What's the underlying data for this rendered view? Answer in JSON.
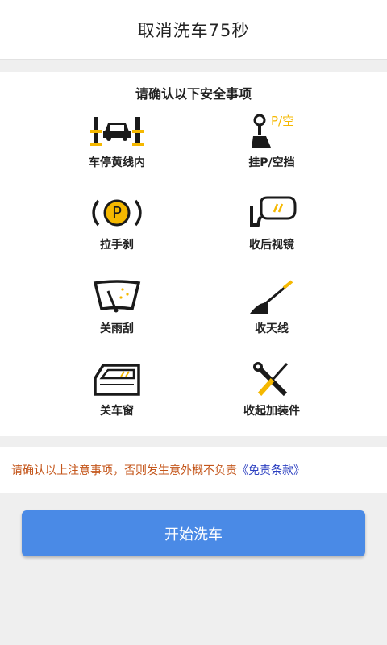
{
  "header": {
    "title": "取消洗车75秒"
  },
  "panel": {
    "title": "请确认以下安全事项",
    "items": [
      {
        "label": "车停黄线内",
        "icon": "car-between-lines-icon"
      },
      {
        "label": "挂P/空挡",
        "icon": "gear-shift-icon",
        "icon_text": "P/空"
      },
      {
        "label": "拉手刹",
        "icon": "parking-brake-icon",
        "icon_text": "P"
      },
      {
        "label": "收后视镜",
        "icon": "side-mirror-icon"
      },
      {
        "label": "关雨刮",
        "icon": "wiper-icon"
      },
      {
        "label": "收天线",
        "icon": "antenna-icon"
      },
      {
        "label": "关车窗",
        "icon": "car-window-icon"
      },
      {
        "label": "收起加装件",
        "icon": "tools-icon"
      }
    ]
  },
  "notice": {
    "text": "请确认以上注意事项，否则发生意外概不负责",
    "link": "《免责条款》"
  },
  "start_button": {
    "label": "开始洗车"
  },
  "colors": {
    "accent_blue": "#4a8ae6",
    "icon_yellow": "#f5b800",
    "notice_orange": "#c4561b",
    "link_blue": "#2b3fc0"
  }
}
